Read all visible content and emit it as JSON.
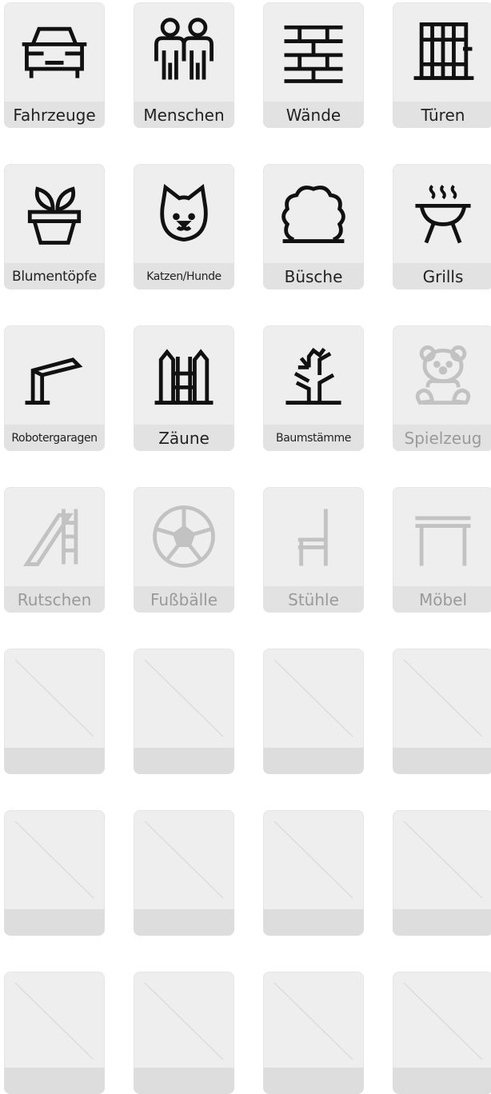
{
  "colors": {
    "tile_bg": "#eeeeee",
    "label_bg": "#e2e2e2",
    "active_text": "#222222",
    "disabled_text": "#9a9a9a",
    "icon_active": "#111111",
    "icon_disabled": "#c2c2c2"
  },
  "tiles": [
    {
      "label": "Fahrzeuge",
      "icon": "car-icon",
      "state": "active"
    },
    {
      "label": "Menschen",
      "icon": "people-icon",
      "state": "active"
    },
    {
      "label": "Wände",
      "icon": "brick-wall-icon",
      "state": "active"
    },
    {
      "label": "Türen",
      "icon": "gate-door-icon",
      "state": "active"
    },
    {
      "label": "Blumentöpfe",
      "icon": "flower-pot-icon",
      "state": "active"
    },
    {
      "label": "Katzen/Hunde",
      "icon": "cat-dog-icon",
      "state": "active"
    },
    {
      "label": "Büsche",
      "icon": "bush-icon",
      "state": "active"
    },
    {
      "label": "Grills",
      "icon": "grill-icon",
      "state": "active"
    },
    {
      "label": "Robotergaragen",
      "icon": "robot-garage-icon",
      "state": "active"
    },
    {
      "label": "Zäune",
      "icon": "fence-icon",
      "state": "active"
    },
    {
      "label": "Baumstämme",
      "icon": "tree-trunk-icon",
      "state": "active"
    },
    {
      "label": "Spielzeug",
      "icon": "teddy-bear-icon",
      "state": "disabled"
    },
    {
      "label": "Rutschen",
      "icon": "slide-icon",
      "state": "disabled"
    },
    {
      "label": "Fußbälle",
      "icon": "soccer-ball-icon",
      "state": "disabled"
    },
    {
      "label": "Stühle",
      "icon": "chair-icon",
      "state": "disabled"
    },
    {
      "label": "Möbel",
      "icon": "table-icon",
      "state": "disabled"
    },
    {
      "label": "",
      "icon": "empty-slot-icon",
      "state": "empty"
    },
    {
      "label": "",
      "icon": "empty-slot-icon",
      "state": "empty"
    },
    {
      "label": "",
      "icon": "empty-slot-icon",
      "state": "empty"
    },
    {
      "label": "",
      "icon": "empty-slot-icon",
      "state": "empty"
    },
    {
      "label": "",
      "icon": "empty-slot-icon",
      "state": "empty"
    },
    {
      "label": "",
      "icon": "empty-slot-icon",
      "state": "empty"
    },
    {
      "label": "",
      "icon": "empty-slot-icon",
      "state": "empty"
    },
    {
      "label": "",
      "icon": "empty-slot-icon",
      "state": "empty"
    },
    {
      "label": "",
      "icon": "empty-slot-icon",
      "state": "empty"
    },
    {
      "label": "",
      "icon": "empty-slot-icon",
      "state": "empty"
    },
    {
      "label": "",
      "icon": "empty-slot-icon",
      "state": "empty"
    },
    {
      "label": "",
      "icon": "empty-slot-icon",
      "state": "empty"
    }
  ]
}
